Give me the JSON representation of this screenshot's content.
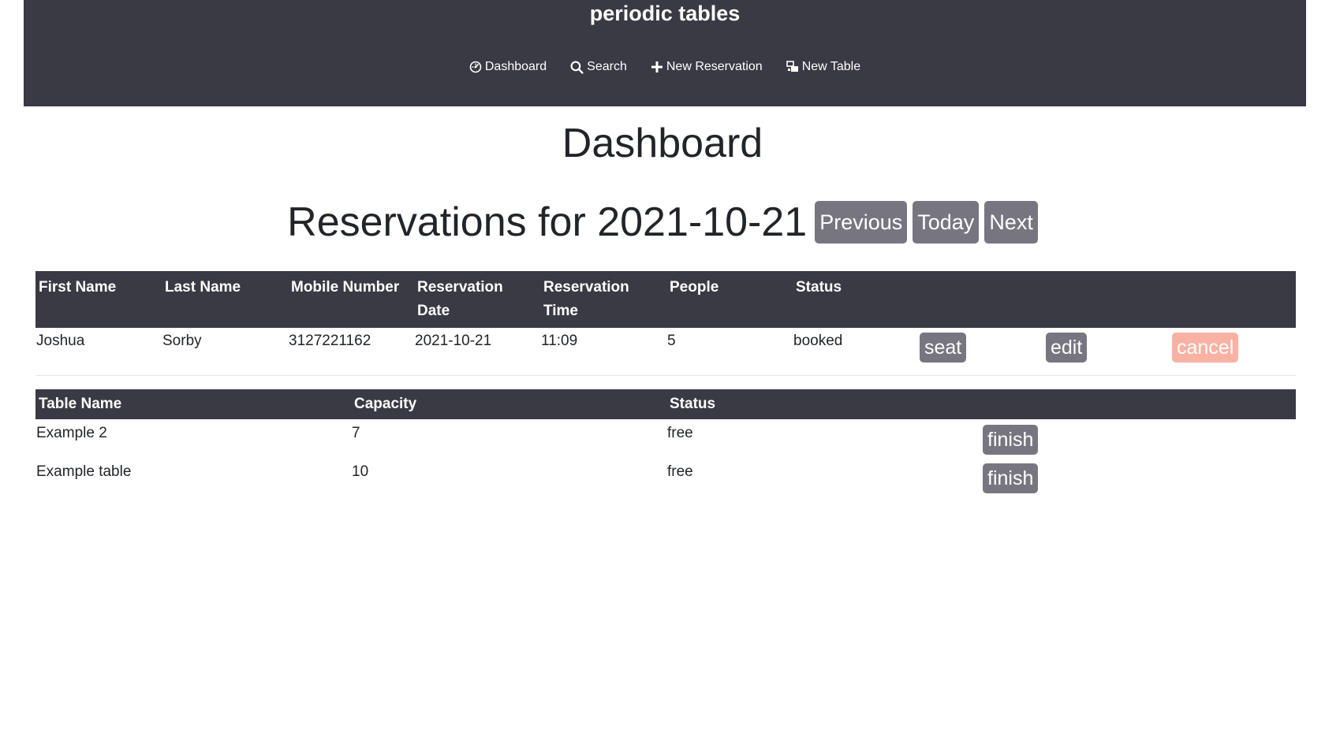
{
  "app": {
    "brand": "periodic tables"
  },
  "nav": {
    "items": [
      {
        "label": "Dashboard",
        "icon": "dashboard-icon"
      },
      {
        "label": "Search",
        "icon": "search-icon"
      },
      {
        "label": "New Reservation",
        "icon": "plus-icon"
      },
      {
        "label": "New Table",
        "icon": "new-table-icon"
      }
    ]
  },
  "page": {
    "title": "Dashboard",
    "reservations_heading": "Reservations for 2021-10-21",
    "date_nav": {
      "previous": "Previous",
      "today": "Today",
      "next": "Next"
    }
  },
  "reservations": {
    "headers": [
      "First Name",
      "Last Name",
      "Mobile Number",
      "Reservation Date",
      "Reservation Time",
      "People",
      "Status"
    ],
    "rows": [
      {
        "first_name": "Joshua",
        "last_name": "Sorby",
        "mobile": "3127221162",
        "date": "2021-10-21",
        "time": "11:09",
        "people": "5",
        "status": "booked",
        "seat_label": "seat",
        "edit_label": "edit",
        "cancel_label": "cancel"
      }
    ]
  },
  "tables": {
    "headers": [
      "Table Name",
      "Capacity",
      "Status"
    ],
    "rows": [
      {
        "name": "Example 2",
        "capacity": "7",
        "status": "free",
        "finish_label": "finish"
      },
      {
        "name": "Example table",
        "capacity": "10",
        "status": "free",
        "finish_label": "finish"
      }
    ]
  },
  "colors": {
    "header_bg": "#3a3a45",
    "button_bg": "#777680",
    "cancel_bg": "#f9b1a3"
  }
}
